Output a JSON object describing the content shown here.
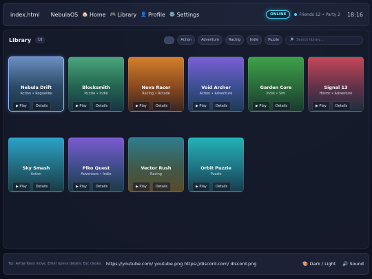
{
  "topbar": {
    "file": "index.html",
    "brand": "NebulaOS",
    "nav": [
      {
        "icon": "🏠",
        "label": "Home"
      },
      {
        "icon": "🎮",
        "label": "Library"
      },
      {
        "icon": "👤",
        "label": "Profile"
      },
      {
        "icon": "⚙️",
        "label": "Settings"
      }
    ],
    "status": "ONLINE",
    "friends": "Friends 12 • Party 2",
    "time": "18:16"
  },
  "library": {
    "title": "Library",
    "count": "10",
    "filters": [
      "Action",
      "Adventure",
      "Racing",
      "Indie",
      "Puzzle"
    ],
    "search_placeholder": "Search library…",
    "play_label": "▶ Play",
    "details_label": "Details",
    "games": [
      {
        "title": "Nebula Drift",
        "genre": "Action • Roguelike",
        "grad": [
          "#6b8fc2",
          "#2b4a66",
          "#1d3145"
        ]
      },
      {
        "title": "Blocksmith",
        "genre": "Puzzle • Indie",
        "grad": [
          "#4aa67a",
          "#236450",
          "#163544"
        ]
      },
      {
        "title": "Nova Racer",
        "genre": "Racing • Arcade",
        "grad": [
          "#d3802a",
          "#8a4a1f",
          "#3a2520"
        ]
      },
      {
        "title": "Void Archer",
        "genre": "Action • Adventure",
        "grad": [
          "#7b5fd6",
          "#3c4f92",
          "#1e3a55"
        ]
      },
      {
        "title": "Garden Core",
        "genre": "Indie • Sim",
        "grad": [
          "#3ea148",
          "#2a6a3a",
          "#1a3b2e"
        ]
      },
      {
        "title": "Signal 13",
        "genre": "Horror • Adventure",
        "grad": [
          "#c64659",
          "#62324a",
          "#1d2e3e"
        ]
      },
      {
        "title": "Sky Smash",
        "genre": "Action",
        "grad": [
          "#2aa3c8",
          "#226a7e",
          "#183b46"
        ]
      },
      {
        "title": "Piko Quest",
        "genre": "Adventure • Indie",
        "grad": [
          "#7a5bd0",
          "#3f4c8a",
          "#1a3b44"
        ]
      },
      {
        "title": "Vector Rush",
        "genre": "Racing",
        "grad": [
          "#2f7d8e",
          "#3e5a4a",
          "#5a4a2a"
        ]
      },
      {
        "title": "Orbit Puzzle",
        "genre": "Puzzle",
        "grad": [
          "#22b3b6",
          "#1f7484",
          "#173c4c"
        ]
      }
    ]
  },
  "footer": {
    "tip": "Tip: Arrow Keys move, Enter opens details, Esc closes.",
    "links": "https://youtube.com/ youtube.png https://discord.com/ discord.png",
    "theme": "🎨 Dark / Light",
    "sound": "🔊 Sound"
  }
}
